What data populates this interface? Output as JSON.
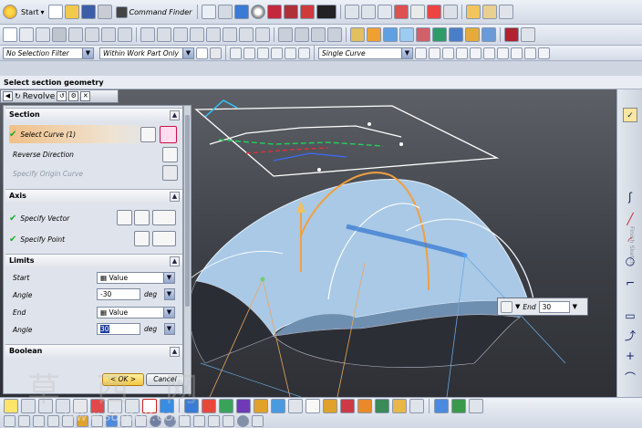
{
  "toolbar1": {
    "start_label": "Start",
    "command_finder_label": "Command Finder"
  },
  "toolbar3": {
    "selection_filter": "No Selection Filter",
    "scope": "Within Work Part Only",
    "curve_rule": "Single Curve"
  },
  "status": {
    "prompt": "Select section geometry"
  },
  "dialog": {
    "title": "Revolve",
    "section": {
      "header": "Section",
      "select_curve": "Select Curve (1)",
      "reverse_direction": "Reverse Direction",
      "specify_origin_curve": "Specify Origin Curve"
    },
    "axis": {
      "header": "Axis",
      "specify_vector": "Specify Vector",
      "specify_point": "Specify Point"
    },
    "limits": {
      "header": "Limits",
      "start_label": "Start",
      "start_mode": "Value",
      "start_angle_label": "Angle",
      "start_angle": "-30",
      "start_unit": "deg",
      "end_label": "End",
      "end_mode": "Value",
      "end_angle_label": "Angle",
      "end_angle": "30",
      "end_unit": "deg"
    },
    "boolean": {
      "header": "Boolean"
    },
    "ok_label": "< OK >",
    "cancel_label": "Cancel"
  },
  "floating_input": {
    "label": "End",
    "value": "30"
  },
  "sidebar": {
    "title": "Finish Sketch"
  },
  "watermark": {
    "chars": "草 西 网",
    "url": "www.sdmox.com"
  },
  "colors": {
    "surface": "#a9c9e6",
    "viewport_top": "#5d6066",
    "accent_orange": "#f0a040",
    "ok_yellow": "#f4c640"
  }
}
